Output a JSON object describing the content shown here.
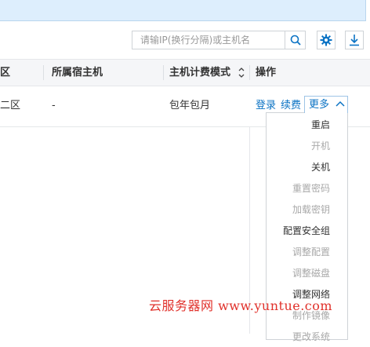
{
  "toolbar": {
    "search_placeholder": "请输IP(换行分隔)或主机名",
    "search_icon": "search-icon",
    "settings_icon": "gear-icon",
    "download_icon": "download-icon",
    "accent": "#0b73c4"
  },
  "table": {
    "columns": [
      {
        "label": "区"
      },
      {
        "label": "所属宿主机"
      },
      {
        "label": "主机计费模式",
        "sortable": true
      },
      {
        "label": "操作"
      }
    ],
    "rows": [
      {
        "zone": "二区",
        "host": "-",
        "billing": "包年包月",
        "actions": [
          "登录",
          "续费"
        ],
        "more_label": "更多"
      }
    ]
  },
  "more_menu": {
    "items": [
      {
        "label": "重启",
        "enabled": true
      },
      {
        "label": "开机",
        "enabled": false
      },
      {
        "label": "关机",
        "enabled": true
      },
      {
        "label": "重置密码",
        "enabled": false
      },
      {
        "label": "加载密钥",
        "enabled": false
      },
      {
        "label": "配置安全组",
        "enabled": true
      },
      {
        "label": "调整配置",
        "enabled": false
      },
      {
        "label": "调整磁盘",
        "enabled": false
      },
      {
        "label": "调整网络",
        "enabled": true
      },
      {
        "label": "制作镜像",
        "enabled": false
      },
      {
        "label": "更改系统",
        "enabled": false
      }
    ]
  },
  "watermark": "云服务器网 www.yuntue.com"
}
